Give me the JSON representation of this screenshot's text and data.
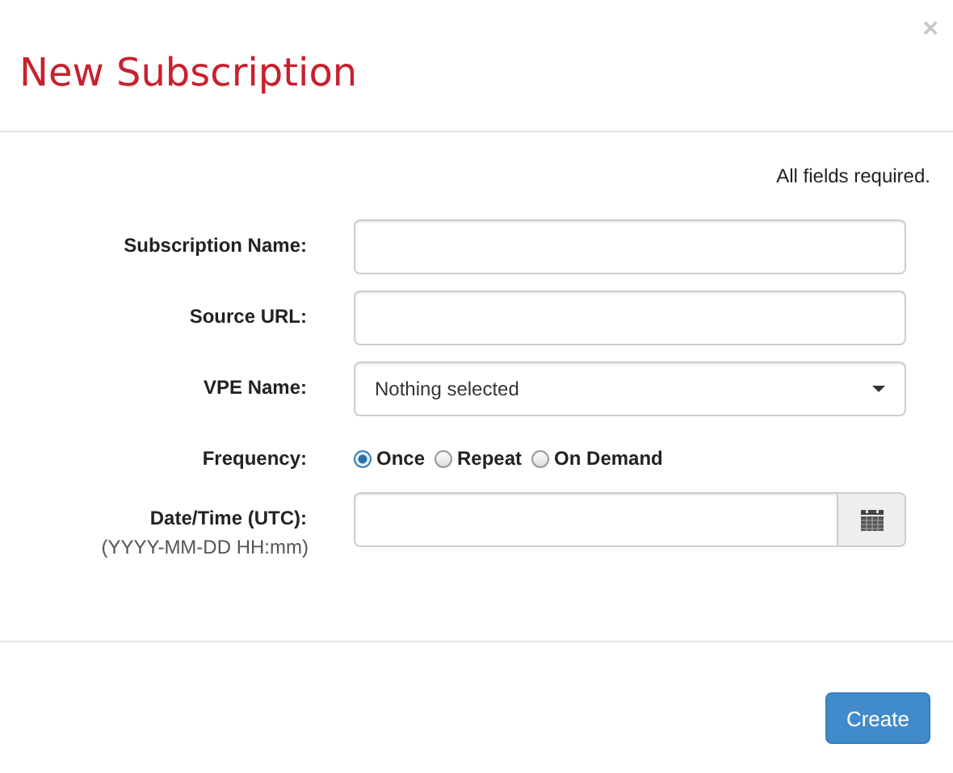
{
  "dialog": {
    "title": "New Subscription",
    "close": "×"
  },
  "note": "All fields required.",
  "fields": [
    {
      "kind": "text",
      "label": "Subscription Name:"
    },
    {
      "kind": "text",
      "label": "Source URL:"
    },
    {
      "kind": "select",
      "label": "VPE Name:",
      "value": "Nothing selected"
    },
    {
      "kind": "radio",
      "label": "Frequency:",
      "options": [
        {
          "label": "Once",
          "selected": true
        },
        {
          "label": "Repeat",
          "selected": false
        },
        {
          "label": "On Demand",
          "selected": false
        }
      ]
    },
    {
      "kind": "datetime",
      "label": "Date/Time (UTC):",
      "hint": "(YYYY-MM-DD HH:mm)"
    }
  ],
  "buttons": [
    "Create"
  ]
}
